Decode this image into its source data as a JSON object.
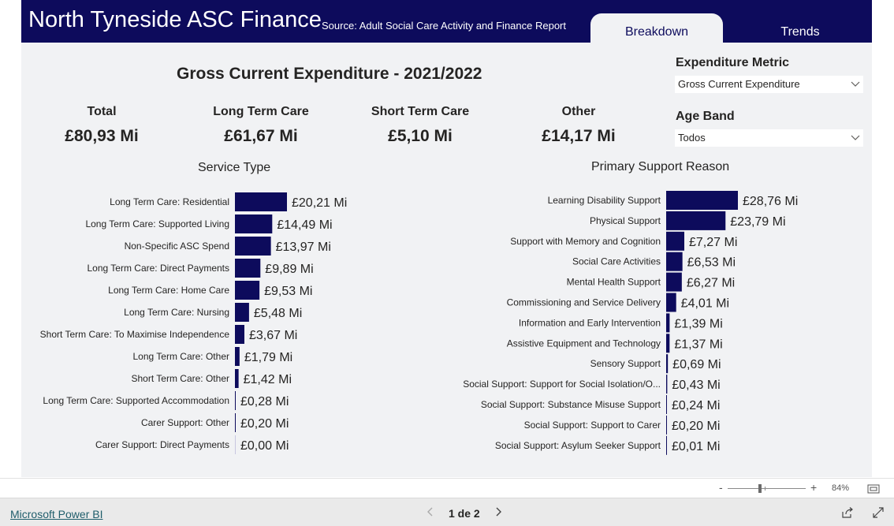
{
  "header": {
    "title": "North Tyneside ASC Finance",
    "source": "Source: Adult Social Care Activity and Finance Report",
    "tabs": [
      "Breakdown",
      "Trends"
    ],
    "active_tab": "Breakdown"
  },
  "main_title": "Gross Current Expenditure - 2021/2022",
  "kpis": [
    {
      "label": "Total",
      "value": "£80,93 Mi"
    },
    {
      "label": "Long Term Care",
      "value": "£61,67 Mi"
    },
    {
      "label": "Short Term Care",
      "value": "£5,10 Mi"
    },
    {
      "label": "Other",
      "value": "£14,17 Mi"
    }
  ],
  "filters": {
    "metric": {
      "label": "Expenditure Metric",
      "value": "Gross Current Expenditure"
    },
    "age_band": {
      "label": "Age Band",
      "value": "Todos"
    }
  },
  "colors": {
    "header": "#0d0b5c",
    "bar": "#0d0b5c",
    "canvas": "#f1f2f4"
  },
  "chart_data": [
    {
      "type": "bar",
      "orientation": "horizontal",
      "title": "Service Type",
      "categories": [
        "Long Term Care: Residential",
        "Long Term Care: Supported Living",
        "Non-Specific ASC Spend",
        "Long Term Care: Direct Payments",
        "Long Term Care: Home Care",
        "Long Term Care: Nursing",
        "Short Term Care: To Maximise Independence",
        "Long Term Care: Other",
        "Short Term Care: Other",
        "Long Term Care: Supported Accommodation",
        "Carer Support: Other",
        "Carer Support: Direct Payments"
      ],
      "values": [
        20.21,
        14.49,
        13.97,
        9.89,
        9.53,
        5.48,
        3.67,
        1.79,
        1.42,
        0.28,
        0.2,
        0.0
      ],
      "value_labels": [
        "£20,21 Mi",
        "£14,49 Mi",
        "£13,97 Mi",
        "£9,89 Mi",
        "£9,53 Mi",
        "£5,48 Mi",
        "£3,67 Mi",
        "£1,79 Mi",
        "£1,42 Mi",
        "£0,28 Mi",
        "£0,20 Mi",
        "£0,00 Mi"
      ]
    },
    {
      "type": "bar",
      "orientation": "horizontal",
      "title": "Primary Support Reason",
      "categories": [
        "Learning Disability Support",
        "Physical Support",
        "Support with Memory and Cognition",
        "Social Care Activities",
        "Mental Health Support",
        "Commissioning and Service Delivery",
        "Information and Early Intervention",
        "Assistive Equipment and Technology",
        "Sensory Support",
        "Social Support: Support for Social Isolation/O...",
        "Social Support: Substance Misuse Support",
        "Social Support: Support to Carer",
        "Social Support: Asylum Seeker Support"
      ],
      "values": [
        28.76,
        23.79,
        7.27,
        6.53,
        6.27,
        4.01,
        1.39,
        1.37,
        0.69,
        0.43,
        0.24,
        0.2,
        0.01
      ],
      "value_labels": [
        "£28,76 Mi",
        "£23,79 Mi",
        "£7,27 Mi",
        "£6,53 Mi",
        "£6,27 Mi",
        "£4,01 Mi",
        "£1,39 Mi",
        "£1,37 Mi",
        "£0,69 Mi",
        "£0,43 Mi",
        "£0,24 Mi",
        "£0,20 Mi",
        "£0,01 Mi"
      ]
    }
  ],
  "status_bar": {
    "minus": "-",
    "plus": "+",
    "zoom": "84%"
  },
  "footer": {
    "brand": "Microsoft Power BI",
    "page": "1 de 2"
  }
}
